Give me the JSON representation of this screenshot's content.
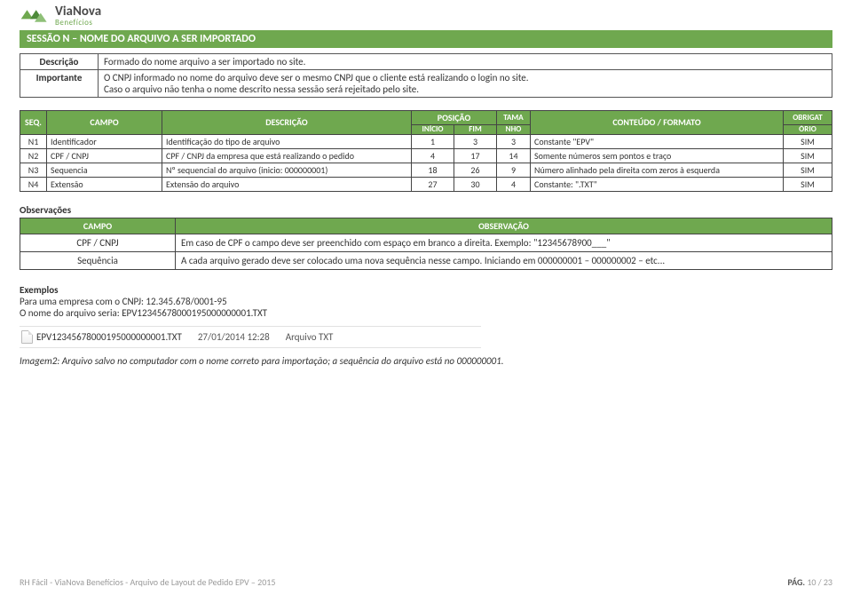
{
  "logo": {
    "line1": "ViaNova",
    "line2": "Benefícios"
  },
  "section_title": "SESSÃO N – NOME DO ARQUIVO A SER IMPORTADO",
  "desc": {
    "label_descricao": "Descrição",
    "label_importante": "Importante",
    "descricao": "Formado do nome arquivo a ser importado no site.",
    "importante_l1": "O CNPJ informado no nome do arquivo deve ser o mesmo CNPJ que o cliente está realizando o login no site.",
    "importante_l2": "Caso o arquivo não tenha o nome descrito nessa sessão será rejeitado pelo site."
  },
  "spec": {
    "headers": {
      "seq": "SEQ.",
      "campo": "CAMPO",
      "descricao": "DESCRIÇÃO",
      "posicao": "POSIÇÃO",
      "inicio": "INÍCIO",
      "fim": "FIM",
      "tamanho_l1": "TAMA",
      "tamanho_l2": "NHO",
      "conteudo": "CONTEÚDO / FORMATO",
      "obrig_l1": "OBRIGAT",
      "obrig_l2": "ÓRIO"
    },
    "rows": [
      {
        "seq": "N1",
        "campo": "Identificador",
        "desc": "Identificação do tipo de arquivo",
        "ini": "1",
        "fim": "3",
        "tam": "3",
        "cont": "Constante \"EPV\"",
        "obr": "SIM"
      },
      {
        "seq": "N2",
        "campo": "CPF / CNPJ",
        "desc": "CPF / CNPJ da empresa que está realizando o pedido",
        "ini": "4",
        "fim": "17",
        "tam": "14",
        "cont": "Somente números sem pontos e traço",
        "obr": "SIM"
      },
      {
        "seq": "N3",
        "campo": "Sequencia",
        "desc": "Nº sequencial do arquivo (inicio: 000000001)",
        "ini": "18",
        "fim": "26",
        "tam": "9",
        "cont": "Número alinhado pela direita com zeros à esquerda",
        "obr": "SIM"
      },
      {
        "seq": "N4",
        "campo": "Extensão",
        "desc": "Extensão do arquivo",
        "ini": "27",
        "fim": "30",
        "tam": "4",
        "cont": "Constante: \".TXT\"",
        "obr": "SIM"
      }
    ]
  },
  "obs": {
    "heading": "Observações",
    "header_campo": "CAMPO",
    "header_obs": "OBSERVAÇÃO",
    "rows": [
      {
        "campo": "CPF / CNPJ",
        "text": "Em caso de CPF o campo deve ser preenchido com espaço em branco a direita. Exemplo: \"12345678900___\""
      },
      {
        "campo": "Sequência",
        "text": "A cada arquivo gerado deve ser colocado uma nova sequência nesse campo. Iniciando em 000000001 – 000000002 – etc..."
      }
    ]
  },
  "examples": {
    "heading": "Exemplos",
    "line1": "Para uma empresa com o CNPJ: 12.345.678/0001-95",
    "line2": "O nome do arquivo seria: EPV12345678000195000000001.TXT",
    "file": {
      "name": "EPV12345678000195000000001.TXT",
      "date": "27/01/2014 12:28",
      "type": "Arquivo TXT"
    },
    "caption": "Imagem2: Arquivo salvo no computador com o nome correto para importação; a sequência do arquivo  está no 000000001."
  },
  "footer": {
    "left": "RH Fácil - ViaNova Benefícios - Arquivo de Layout de Pedido  EPV – 2015",
    "page_label": "PÁG.",
    "page_value": "10 / 23"
  }
}
